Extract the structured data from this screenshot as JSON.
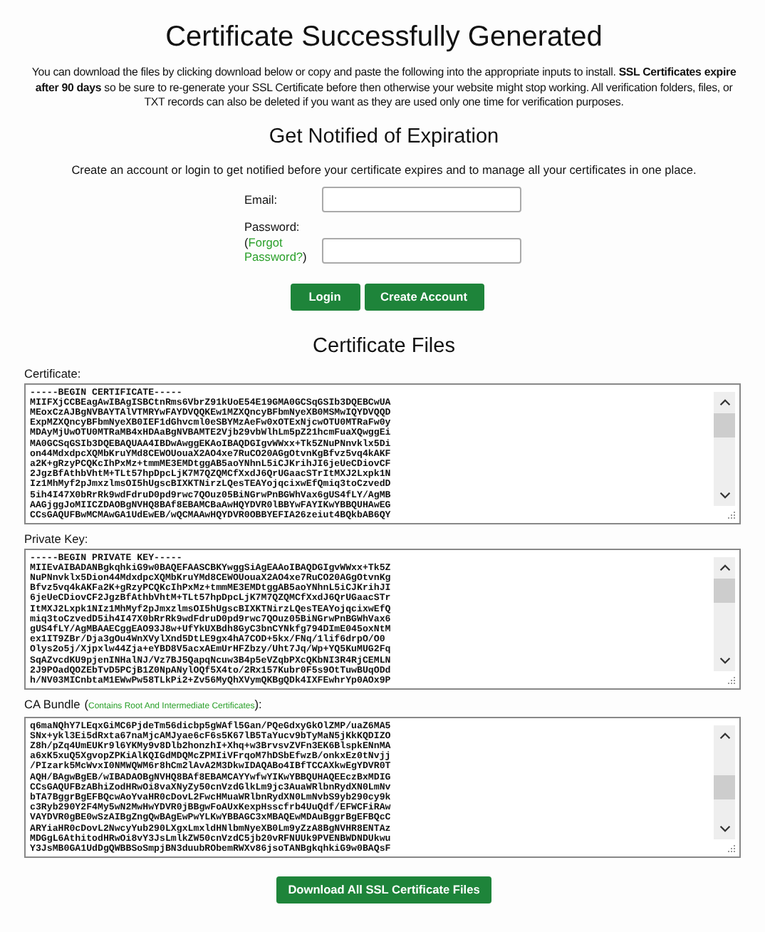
{
  "title": "Certificate Successfully Generated",
  "intro": "You can download the files by clicking download below or copy and paste the following into the appropriate inputs to install. **SSL Certificates expire after 90 days** so be sure to re-generate your SSL Certificate before then otherwise your website might stop working. All verification folders, files, or TXT records can also be deleted if you want as they are used only one time for verification purposes.",
  "notify": {
    "heading": "Get Notified of Expiration",
    "text": "Create an account or login to get notified before your certificate expires and to manage all your certificates in one place.",
    "email": {
      "label": "Email:"
    },
    "password": {
      "label": "Password:",
      "link_prefix": "(",
      "link": "Forgot Password?",
      "link_suffix": ")"
    },
    "buttons": [
      "Login",
      "Create Account"
    ]
  },
  "files_heading": "Certificate Files",
  "files": [
    {
      "label": "Certificate:",
      "lines": [
        "-----BEGIN CERTIFICATE-----",
        "MIIFXjCCBEagAwIBAgISBCtnRms6VbrZ91kUoE54E19GMA0GCSqGSIb3DQEBCwUA",
        "MEoxCzAJBgNVBAYTAlVTMRYwFAYDVQQKEw1MZXQncyBFbmNyeXB0MSMwIQYDVQQD",
        "ExpMZXQncyBFbmNyeXB0IEF1dGhvcml0eSBYMzAeFw0xOTExNjcwOTU0MTRaFw0y",
        "MDAyMjUwOTU0MTRaMB4xHDAaBgNVBAMTE2Vjb29vbWlhLm5pZ21hcmFuaXQwggEi",
        "MA0GCSqGSIb3DQEBAQUAA4IBDwAwggEKAoIBAQDGIgvWWxx+Tk5ZNuPNnvklx5Di",
        "on44MdxdpcXQMbKruYMd8CEWOUouaX2AO4xe7RuCO20AGgOtvnKgBfvz5vq4kAKF",
        "a2K+gRzyPCQKcIhPxMz+tmmME3EMDtggAB5aoYNhnL5iCJKrihJI6jeUeCDiovCF",
        "2JgzBfAthbVhtM+TLt57hpDpcLjK7M7QZQMCfXxdJ6QrUGaacSTrItMXJ2Lxpk1N",
        "Iz1MhMyf2pJmxzlmsOI5hUgscBIXKTNirzLQesTEAYojqcixwEfQmiq3toCzvedD",
        "5ih4I47X0bRrRk9wdFdruD0pd9rwc7QOuz05BiNGrwPnBGWhVax6gUS4fLY/AgMB",
        "AAGjggJoMIICZDAOBgNVHQ8BAf8EBAMCBaAwHQYDVR0lBBYwFAYIKwYBBQUHAwEG",
        "CCsGAQUFBwMCMAwGA1UdEwEB/wQCMAAwHQYDVR0OBBYEFIA26zeiut4BQkbAB6QY"
      ]
    },
    {
      "label": "Private Key:",
      "lines": [
        "-----BEGIN PRIVATE KEY-----",
        "MIIEvAIBADANBgkqhkiG9w0BAQEFAASCBKYwggSiAgEAAoIBAQDGIgvWWxx+Tk5Z",
        "NuPNnvklx5Dion44MdxdpcXQMbKruYMd8CEWOUouaX2AO4xe7RuCO20AGgOtvnKg",
        "Bfvz5vq4kAKFa2K+gRzyPCQKcIhPxMz+tmmME3EMDtggAB5aoYNhnL5iCJKrihJI",
        "6jeUeCDiovCF2JgzBfAthbVhtM+TLt57hpDpcLjK7M7QZQMCfXxdJ6QrUGaacSTr",
        "ItMXJ2Lxpk1NIz1MhMyf2pJmxzlmsOI5hUgscBIXKTNirzLQesTEAYojqcixwEfQ",
        "miq3toCzvedD5ih4I47X0bRrRk9wdFdruD0pd9rwc7QOuz05BiNGrwPnBGWhVax6",
        "gUS4fLY/AgMBAAECggEAO93J8w+UfYkUXBdh8GyC3bnCYNkfg794DImE045oxNtM",
        "ex1IT9ZBr/Dja3gOu4WnXVylXnd5DtLE9gx4hA7COD+5kx/FNq/1lif6drpO/O0",
        "Olys2o5j/Xjpxlw44Zja+eYBD8V5acxAEmUrHFZbzy/Uht7Jq/Wp+YQ5KuMUG2Fq",
        "SqAZvcdKU9pjenINHalNJ/Vz7BJ5QapqNcuw3B4p5eVZqbPXcQKbNI3R4RjCEMLN",
        "2J9POadQOZEbTvD5PCjB1Z0NpANylOQf5X4to/2Rx157Kubr0F5s9OtTuwBUqODd",
        "h/NV03MICnbtaM1EWwPw58TLkPi2+Zv56MyQhXVymQKBgQDk4IXFEwhrYp0AOx9P"
      ]
    },
    {
      "label": "CA Bundle",
      "note_prefix": "(",
      "note": "Contains Root And Intermediate Certificates",
      "note_suffix": "):",
      "lines": [
        "q6maNQhY7LEqxGiMC6PjdeTm56dicbp5gWAfl5Gan/PQeGdxyGkOlZMP/uaZ6MA5",
        "SNx+ykl3Ei5dRxta67naMjcAMJyae6cF6s5K67lB5TaYucv9bTyMaN5jKkKQDIZO",
        "Z8h/pZq4UmEUKr9l6YKMy9v8Dlb2honzhI+Xhq+w3BrvsvZVFn3EK6BlspkENnMA",
        "a6xK5xuQ5XgvopZPKiAlKQIGdMDQMcZPMIiVFrqoM7hDSbEfwzB/onkxEz0tNvjj",
        "/PIzark5McWvxI0NMWQWM6r8hCm2lAvA2M3DkwIDAQABo4IBfTCCAXkwEgYDVR0T",
        "AQH/BAgwBgEB/wIBADAOBgNVHQ8BAf8EBAMCAYYwfwYIKwYBBQUHAQEEczBxMDIG",
        "CCsGAQUFBzABhiZodHRwOi8vaXNyZy50cnVzdGlkLm9jc3AuaWRlbnRydXN0LmNv",
        "bTA7BggrBgEFBQcwAoYvaHR0cDovL2FwcHMuaWRlbnRydXN0LmNvbS9yb290cy9k",
        "c3Ryb290Y2F4My5wN2MwHwYDVR0jBBgwFoAUxKexpHsscfrb4UuQdf/EFWCFiRAw",
        "VAYDVR0gBE0wSzAIBgZngQwBAgEwPwYLKwYBBAGC3xMBAQEwMDAuBggrBgEFBQcC",
        "ARYiaHR0cDovL2NwcyYub290LXgxLmxldHNlbmNyeXB0Lm9yZzA8BgNVHR8ENTAz",
        "MDGgL6AthitodHRwOi8vY3JsLmlkZW50cnVzdC5jb20vRFNUUk9PVENBWDNDUkwu",
        "Y3JsMB0GA1UdDgQWBBSoSmpjBN3duubRObemRWXv86jsoTANBgkqhkiG9w0BAQsF"
      ]
    }
  ],
  "download_button": "Download All SSL Certificate Files"
}
